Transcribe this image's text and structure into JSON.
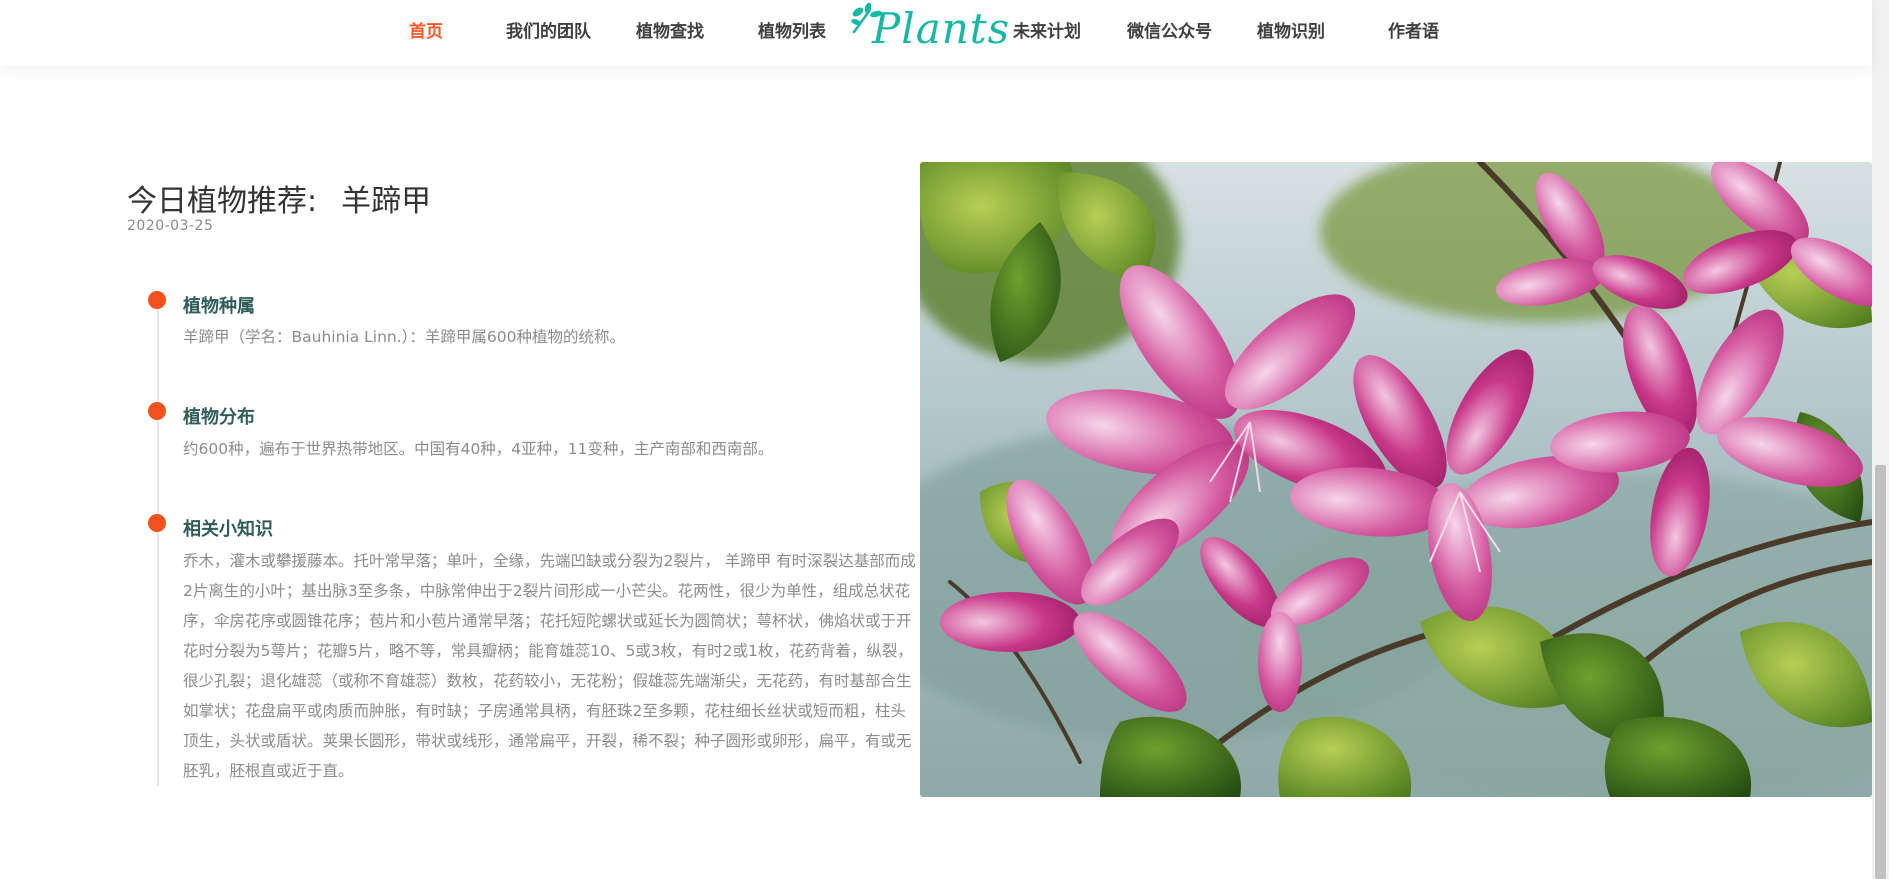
{
  "nav": {
    "items": [
      {
        "label": "首页",
        "active": true
      },
      {
        "label": "我们的团队",
        "active": false
      },
      {
        "label": "植物查找",
        "active": false
      },
      {
        "label": "植物列表",
        "active": false
      },
      {
        "label": "未来计划",
        "active": false
      },
      {
        "label": "微信公众号",
        "active": false
      },
      {
        "label": "植物识别",
        "active": false
      },
      {
        "label": "作者语",
        "active": false
      }
    ],
    "logo_text": "Plants",
    "active_color": "#f05a28",
    "logo_color": "#16b8a3"
  },
  "article": {
    "title_prefix": "今日植物推荐:",
    "plant_name": "羊蹄甲",
    "date": "2020-03-25",
    "sections": [
      {
        "heading": "植物种属",
        "body": "羊蹄甲（学名：Bauhinia Linn.）：羊蹄甲属600种植物的统称。"
      },
      {
        "heading": "植物分布",
        "body": "约600种，遍布于世界热带地区。中国有40种，4亚种，11变种，主产南部和西南部。"
      },
      {
        "heading": "相关小知识",
        "body": "乔木，灌木或攀援藤本。托叶常早落；单叶，全缘，先端凹缺或分裂为2裂片， 羊蹄甲 有时深裂达基部而成2片离生的小叶；基出脉3至多条，中脉常伸出于2裂片间形成一小芒尖。花两性，很少为单性，组成总状花序，伞房花序或圆锥花序；苞片和小苞片通常早落；花托短陀螺状或延长为圆筒状；萼杯状，佛焰状或于开花时分裂为5萼片；花瓣5片，略不等，常具瓣柄；能育雄蕊10、5或3枚，有时2或1枚，花药背着，纵裂，很少孔裂；退化雄蕊（或称不育雄蕊）数枚，花药较小，无花粉；假雄蕊先端渐尖，无花药，有时基部合生如掌状；花盘扁平或肉质而肿胀，有时缺；子房通常具柄，有胚珠2至多颗，花柱细长丝状或短而粗，柱头顶生，头状或盾状。荚果长圆形，带状或线形，通常扁平，开裂，稀不裂；种子圆形或卵形，扁平，有或无胚乳，胚根直或近于直。"
      }
    ],
    "bullet_color": "#f4511e"
  },
  "photo": {
    "subject": "bauhinia-flowers-photo"
  }
}
